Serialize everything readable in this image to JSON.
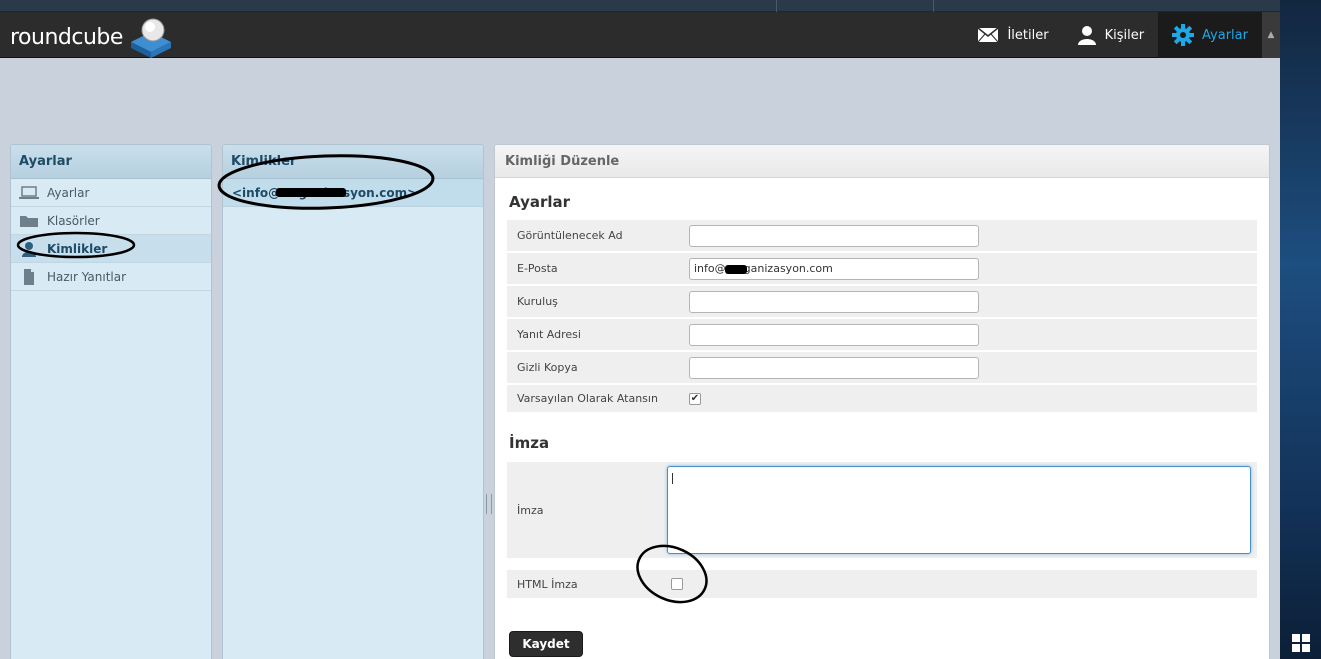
{
  "logo": {
    "text": "roundcube"
  },
  "nav": {
    "items": [
      {
        "label": "İletiler",
        "icon": "envelope-icon"
      },
      {
        "label": "Kişiler",
        "icon": "person-icon"
      },
      {
        "label": "Ayarlar",
        "icon": "gear-icon",
        "active": true
      }
    ],
    "collapse_glyph": "▲"
  },
  "settings_panel": {
    "title": "Ayarlar",
    "items": [
      {
        "label": "Ayarlar",
        "icon": "laptop-icon"
      },
      {
        "label": "Klasörler",
        "icon": "folder-icon"
      },
      {
        "label": "Kimlikler",
        "icon": "person-icon",
        "selected": true
      },
      {
        "label": "Hazır Yanıtlar",
        "icon": "document-icon"
      }
    ]
  },
  "identities_panel": {
    "title": "Kimlikler",
    "items": [
      {
        "label": "<info@ organizasyon.com>"
      }
    ]
  },
  "edit_panel": {
    "title": "Kimliği Düzenle",
    "settings_section": "Ayarlar",
    "fields": {
      "display_name": {
        "label": "Görüntülenecek Ad",
        "value": ""
      },
      "email": {
        "label": "E-Posta",
        "value": "info@  organizasyon.com"
      },
      "organization": {
        "label": "Kuruluş",
        "value": ""
      },
      "reply_to": {
        "label": "Yanıt Adresi",
        "value": ""
      },
      "bcc": {
        "label": "Gizli Kopya",
        "value": ""
      },
      "default": {
        "label": "Varsayılan Olarak Atansın",
        "checked": true,
        "check_glyph": "✔"
      }
    },
    "signature_section": "İmza",
    "signature": {
      "label": "İmza",
      "value": ""
    },
    "html_signature": {
      "label": "HTML İmza",
      "checked": false
    },
    "save_label": "Kaydet"
  },
  "colors": {
    "header_bg": "#2c2c2c",
    "active_nav": "#1fa8e8",
    "panel_bg": "#d8eaf4",
    "panel_head": "#1e4b66"
  }
}
